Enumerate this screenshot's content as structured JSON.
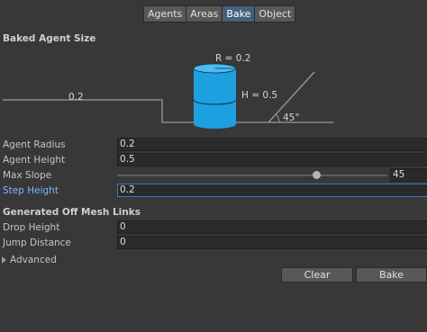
{
  "tabs": [
    "Agents",
    "Areas",
    "Bake",
    "Object"
  ],
  "active_tab": "Bake",
  "baked_agent_size": {
    "title": "Baked Agent Size",
    "diagram": {
      "radius_label": "R = 0.2",
      "height_label": "H = 0.5",
      "step_label": "0.2",
      "slope_label": "45°"
    }
  },
  "fields": {
    "agent_radius": {
      "label": "Agent Radius",
      "value": "0.2"
    },
    "agent_height": {
      "label": "Agent Height",
      "value": "0.5"
    },
    "max_slope": {
      "label": "Max Slope",
      "value": "45"
    },
    "step_height": {
      "label": "Step Height",
      "value": "0.2"
    }
  },
  "off_mesh": {
    "title": "Generated Off Mesh Links",
    "drop_height": {
      "label": "Drop Height",
      "value": "0"
    },
    "jump_distance": {
      "label": "Jump Distance",
      "value": "0"
    }
  },
  "advanced": {
    "label": "Advanced"
  },
  "buttons": {
    "clear": "Clear",
    "bake": "Bake"
  },
  "colors": {
    "background": "#383838",
    "cylinder": "#1e9fe0",
    "accent": "#3a79c0"
  }
}
